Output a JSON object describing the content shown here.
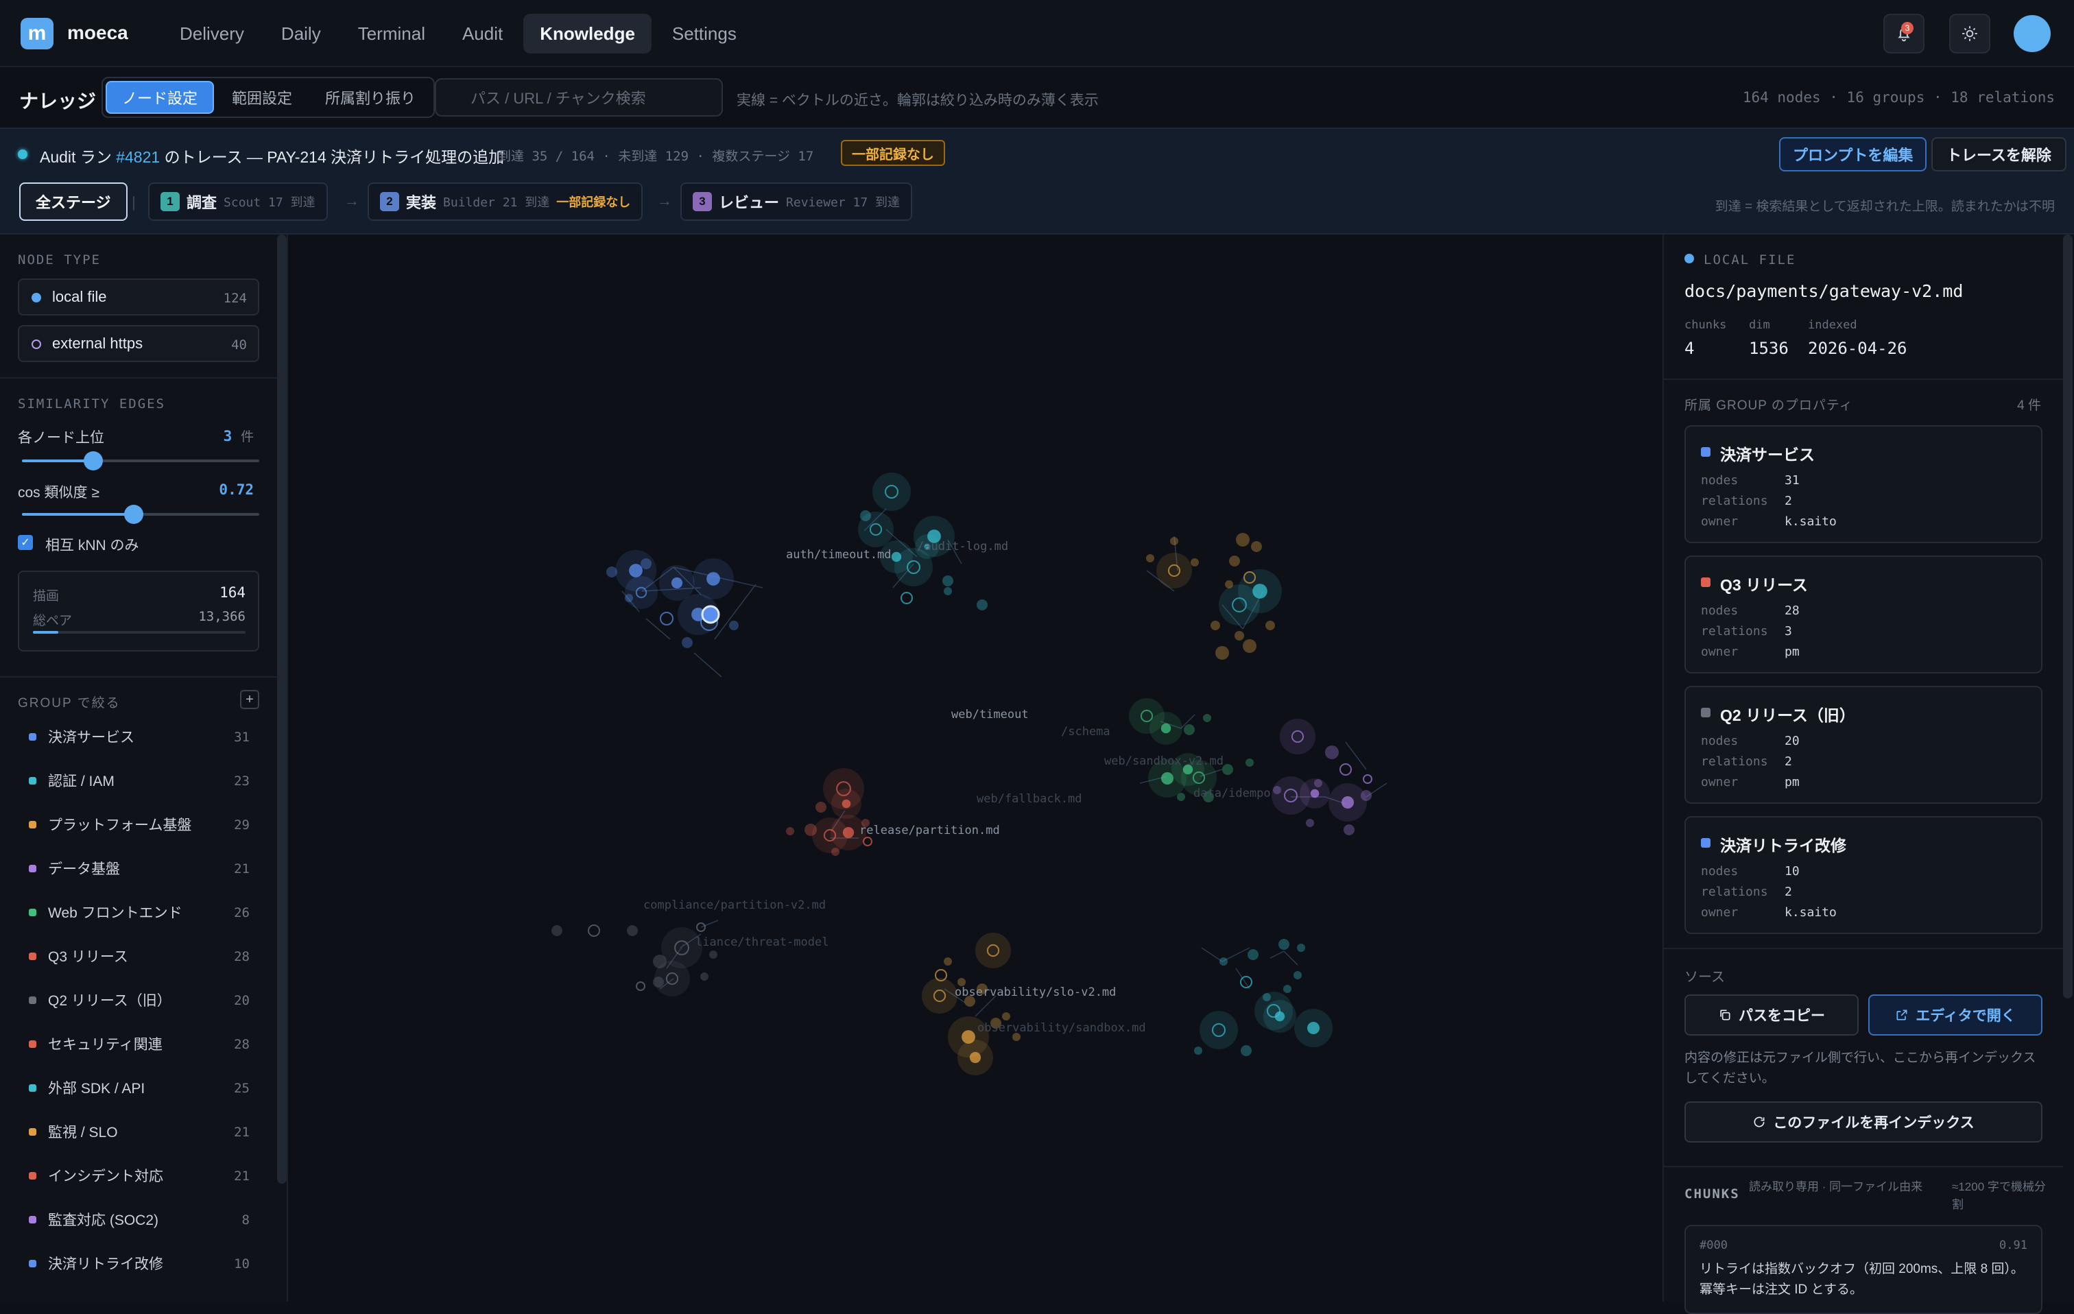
{
  "app": {
    "logo_letter": "m",
    "name": "moeca"
  },
  "nav": {
    "tabs": [
      {
        "label": "Delivery"
      },
      {
        "label": "Daily"
      },
      {
        "label": "Terminal"
      },
      {
        "label": "Audit"
      },
      {
        "label": "Knowledge",
        "active": true
      },
      {
        "label": "Settings"
      }
    ],
    "notif_count": "3"
  },
  "subheader": {
    "title": "ナレッジ",
    "segments": [
      "ノード設定",
      "範囲設定",
      "所属割り振り"
    ],
    "search_placeholder": "パス / URL / チャンク検索",
    "hint": "実線 = ベクトルの近さ。輪郭は絞り込み時のみ薄く表示",
    "stats": "164 nodes · 16 groups · 18 relations"
  },
  "trace": {
    "title_prefix": "Audit ラン ",
    "run_id": "#4821",
    "title_suffix": " のトレース — PAY-214 決済リトライ処理の追加",
    "meta": "到達 35 / 164 · 未到達 129 · 複数ステージ 17",
    "partial_badge": "一部記録なし",
    "edit_prompt": "プロンプトを編集",
    "clear_trace": "トレースを解除",
    "all_stages": "全ステージ",
    "stages": [
      {
        "num": "1",
        "name": "調査",
        "meta": "Scout 17 到達",
        "warn": "",
        "color": "#3fa8a0"
      },
      {
        "num": "2",
        "name": "実装",
        "meta": "Builder 21 到達",
        "warn": "一部記録なし",
        "color": "#5a7ec8"
      },
      {
        "num": "3",
        "name": "レビュー",
        "meta": "Reviewer 17 到達",
        "warn": "",
        "color": "#8a6ab8"
      }
    ],
    "note": "到達 = 検索結果として返却された上限。読まれたかは不明"
  },
  "sidebar": {
    "node_type_label": "NODE TYPE",
    "node_types": [
      {
        "label": "local file",
        "count": "124",
        "color": "#5aa8f0"
      },
      {
        "label": "external https",
        "count": "40",
        "color": "#b89af0"
      }
    ],
    "similarity_label": "SIMILARITY EDGES",
    "topk_label": "各ノード上位",
    "topk_value": "3",
    "topk_unit": "件",
    "topk_fraction": 0.3,
    "cos_label": "cos 類似度 ≥",
    "cos_value": "0.72",
    "cos_fraction": 0.47,
    "mutual_label": "相互 kNN のみ",
    "draw_label": "描画",
    "draw_value": "164",
    "pairs_label": "総ペア",
    "pairs_value": "13,366",
    "draw_fraction": 0.12,
    "group_filter_label": "GROUP で絞る",
    "groups": [
      {
        "label": "決済サービス",
        "count": "31",
        "color": "#5a8ef0"
      },
      {
        "label": "認証 / IAM",
        "count": "23",
        "color": "#38c0d0"
      },
      {
        "label": "プラットフォーム基盤",
        "count": "29",
        "color": "#e0a040"
      },
      {
        "label": "データ基盤",
        "count": "21",
        "color": "#a87ee0"
      },
      {
        "label": "Web フロントエンド",
        "count": "26",
        "color": "#40c080"
      },
      {
        "label": "Q3 リリース",
        "count": "28",
        "color": "#e06050"
      },
      {
        "label": "Q2 リリース（旧）",
        "count": "20",
        "color": "#6a717c"
      },
      {
        "label": "セキュリティ関連",
        "count": "28",
        "color": "#e06050"
      },
      {
        "label": "外部 SDK / API",
        "count": "25",
        "color": "#38c0d0"
      },
      {
        "label": "監視 / SLO",
        "count": "21",
        "color": "#e0a040"
      },
      {
        "label": "インシデント対応",
        "count": "21",
        "color": "#e06050"
      },
      {
        "label": "監査対応 (SOC2)",
        "count": "8",
        "color": "#a87ee0"
      },
      {
        "label": "決済リトライ改修",
        "count": "10",
        "color": "#5a8ef0"
      }
    ]
  },
  "graph": {
    "labels": [
      "auth/timeout.md",
      "/audit-log.md",
      "web/timeout",
      "/schema",
      "web/sandbox-v2.md",
      "web/fallback.md",
      "data/idempo",
      "release/partition.md",
      "compliance/partition-v2.md",
      "liance/threat-model",
      "observability/slo-v2.md",
      "observability/sandbox.md"
    ]
  },
  "detail": {
    "type_label": "LOCAL FILE",
    "path": "docs/payments/gateway-v2.md",
    "meta": [
      {
        "label": "chunks",
        "value": "4"
      },
      {
        "label": "dim",
        "value": "1536"
      },
      {
        "label": "indexed",
        "value": "2026-04-26"
      }
    ],
    "group_header": "所属 GROUP のプロパティ",
    "group_count": "4 件",
    "groups": [
      {
        "name": "決済サービス",
        "nodes": "31",
        "relations": "2",
        "owner": "k.saito",
        "color": "#5a8ef0"
      },
      {
        "name": "Q3 リリース",
        "nodes": "28",
        "relations": "3",
        "owner": "pm",
        "color": "#e06050"
      },
      {
        "name": "Q2 リリース（旧）",
        "nodes": "20",
        "relations": "2",
        "owner": "pm",
        "color": "#6a717c"
      },
      {
        "name": "決済リトライ改修",
        "nodes": "10",
        "relations": "2",
        "owner": "k.saito",
        "color": "#5a8ef0"
      }
    ],
    "k_nodes": "nodes",
    "k_relations": "relations",
    "k_owner": "owner",
    "source_label": "ソース",
    "copy_path": "パスをコピー",
    "open_editor": "エディタで開く",
    "source_note": "内容の修正は元ファイル側で行い、ここから再インデックスしてください。",
    "reindex": "このファイルを再インデックス",
    "chunks_label": "CHUNKS",
    "chunks_note1": "読み取り専用 · 同一ファイル由来",
    "chunks_note2": "≈1200 字で機械分割",
    "chunk": {
      "id": "#000",
      "score": "0.91",
      "text": "リトライは指数バックオフ（初回 200ms、上限 8 回）。冪等キーは注文 ID とする。"
    }
  }
}
